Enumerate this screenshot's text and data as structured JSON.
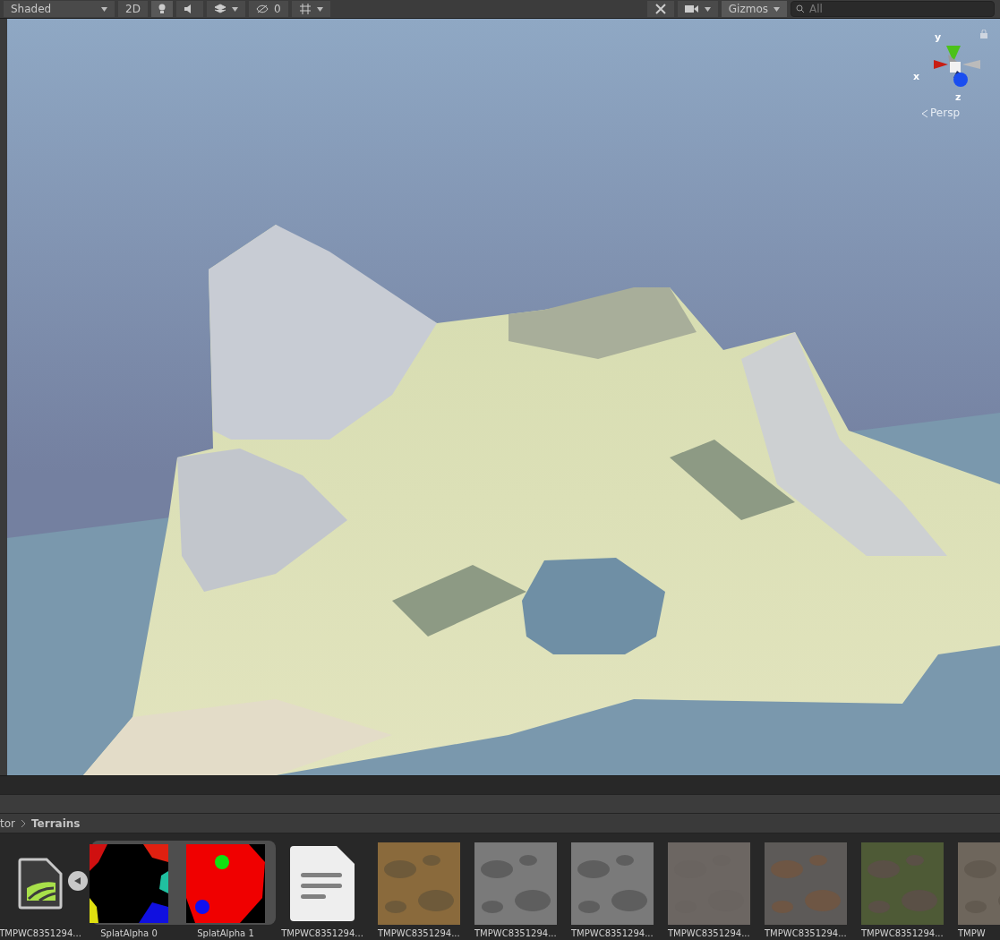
{
  "toolbar": {
    "draw_mode": "Shaded",
    "mode_2d": "2D",
    "lighting": {
      "on": true
    },
    "audio": {
      "on": false
    },
    "hidden_count": "0",
    "gizmos": {
      "label": "Gizmos",
      "on": true
    },
    "search": {
      "placeholder": "All"
    }
  },
  "scene_view": {
    "gizmo": {
      "axes": [
        {
          "label": "y"
        },
        {
          "label": "x"
        },
        {
          "label": "z"
        }
      ],
      "projection": "Persp"
    }
  },
  "project": {
    "breadcrumb": [
      "tor",
      "Terrains"
    ],
    "assets": [
      {
        "kind": "terrain",
        "label": "TMPWC8351294..."
      },
      {
        "kind": "splat",
        "frames": [
          {
            "label": "SplatAlpha 0"
          },
          {
            "label": "SplatAlpha 1"
          }
        ]
      },
      {
        "kind": "document",
        "label": "TMPWC8351294..."
      },
      {
        "kind": "texture",
        "label": "TMPWC8351294..."
      },
      {
        "kind": "texture",
        "label": "TMPWC8351294..."
      },
      {
        "kind": "texture",
        "label": "TMPWC8351294..."
      },
      {
        "kind": "texture",
        "label": "TMPWC8351294..."
      },
      {
        "kind": "texture",
        "label": "TMPWC8351294..."
      },
      {
        "kind": "texture",
        "label": "TMPWC8351294..."
      },
      {
        "kind": "texture",
        "label": "TMPW"
      }
    ]
  }
}
